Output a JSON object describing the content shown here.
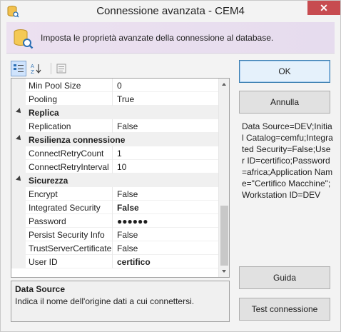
{
  "window": {
    "title": "Connessione avanzata - CEM4",
    "close_label": "✕"
  },
  "banner": {
    "text": "Imposta le proprietà avanzate della connessione al database."
  },
  "toolbar": {
    "items": [
      "categorized-view",
      "alphabetical-sort",
      "property-pages"
    ]
  },
  "grid": {
    "rows": [
      {
        "kind": "prop",
        "name": "Min Pool Size",
        "value": "0",
        "bold": false
      },
      {
        "kind": "prop",
        "name": "Pooling",
        "value": "True",
        "bold": false
      },
      {
        "kind": "cat",
        "name": "Replica"
      },
      {
        "kind": "prop",
        "name": "Replication",
        "value": "False",
        "bold": false
      },
      {
        "kind": "cat",
        "name": "Resilienza connessione"
      },
      {
        "kind": "prop",
        "name": "ConnectRetryCount",
        "value": "1",
        "bold": false
      },
      {
        "kind": "prop",
        "name": "ConnectRetryInterval",
        "value": "10",
        "bold": false
      },
      {
        "kind": "cat",
        "name": "Sicurezza"
      },
      {
        "kind": "prop",
        "name": "Encrypt",
        "value": "False",
        "bold": false
      },
      {
        "kind": "prop",
        "name": "Integrated Security",
        "value": "False",
        "bold": true
      },
      {
        "kind": "prop",
        "name": "Password",
        "value": "●●●●●●",
        "bold": true
      },
      {
        "kind": "prop",
        "name": "Persist Security Info",
        "value": "False",
        "bold": false
      },
      {
        "kind": "prop",
        "name": "TrustServerCertificate",
        "value": "False",
        "bold": false
      },
      {
        "kind": "prop",
        "name": "User ID",
        "value": "certifico",
        "bold": true
      }
    ]
  },
  "description": {
    "title": "Data Source",
    "text": "Indica il nome dell'origine dati a cui connettersi."
  },
  "buttons": {
    "ok": "OK",
    "cancel": "Annulla",
    "help": "Guida",
    "test": "Test connessione"
  },
  "connection_string": "Data Source=DEV;Initial Catalog=cemfu;Integrated Security=False;User ID=certifico;Password=africa;Application Name=\"Certifico Macchine\";Workstation ID=DEV",
  "colors": {
    "accent": "#3c7fb1",
    "close": "#c74b50",
    "banner": "#ece1f0"
  }
}
